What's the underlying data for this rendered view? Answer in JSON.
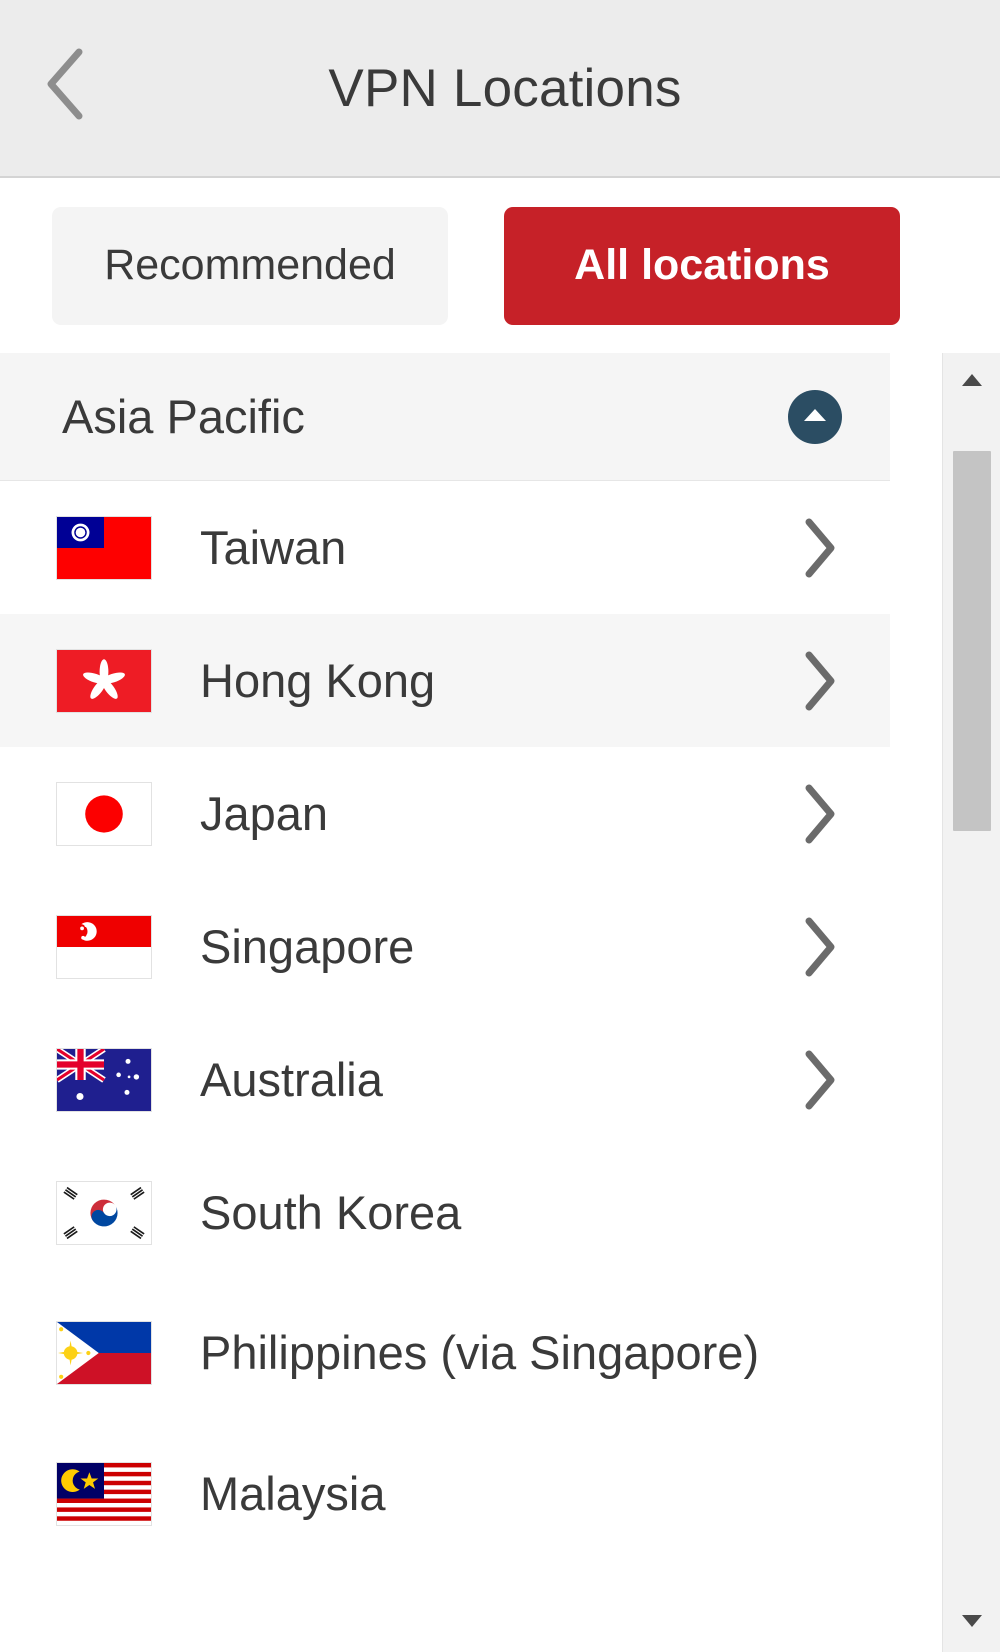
{
  "header": {
    "title": "VPN Locations",
    "back_icon": "chevron-left-icon"
  },
  "tabs": [
    {
      "label": "Recommended",
      "active": false
    },
    {
      "label": "All locations",
      "active": true
    }
  ],
  "colors": {
    "accent_red": "#c62128",
    "header_bg": "#ececec",
    "section_bg": "#f5f5f5",
    "collapse_circle": "#2b4d63",
    "chevron_gray": "#6b6b6b",
    "text": "#3a3a3a",
    "row_alt": "#f6f6f6",
    "scrollbar_thumb": "#c4c4c4"
  },
  "section": {
    "title": "Asia Pacific",
    "collapse_icon": "chevron-up-icon",
    "expanded": true
  },
  "locations": [
    {
      "name": "Taiwan",
      "flag": "flag-taiwan",
      "has_chevron": true,
      "stripe": "white"
    },
    {
      "name": "Hong Kong",
      "flag": "flag-hong-kong",
      "has_chevron": true,
      "stripe": "gray"
    },
    {
      "name": "Japan",
      "flag": "flag-japan",
      "has_chevron": true,
      "stripe": "white"
    },
    {
      "name": "Singapore",
      "flag": "flag-singapore",
      "has_chevron": true,
      "stripe": "white"
    },
    {
      "name": "Australia",
      "flag": "flag-australia",
      "has_chevron": true,
      "stripe": "white"
    },
    {
      "name": "South Korea",
      "flag": "flag-south-korea",
      "has_chevron": false,
      "stripe": "white"
    },
    {
      "name": "Philippines (via Singapore)",
      "flag": "flag-philippines",
      "has_chevron": false,
      "stripe": "white"
    },
    {
      "name": "Malaysia",
      "flag": "flag-malaysia",
      "has_chevron": false,
      "stripe": "white"
    }
  ],
  "scrollbar": {
    "up_icon": "triangle-up-icon",
    "down_icon": "triangle-down-icon",
    "thumb_top_pct": 7,
    "thumb_height_pct": 29
  }
}
